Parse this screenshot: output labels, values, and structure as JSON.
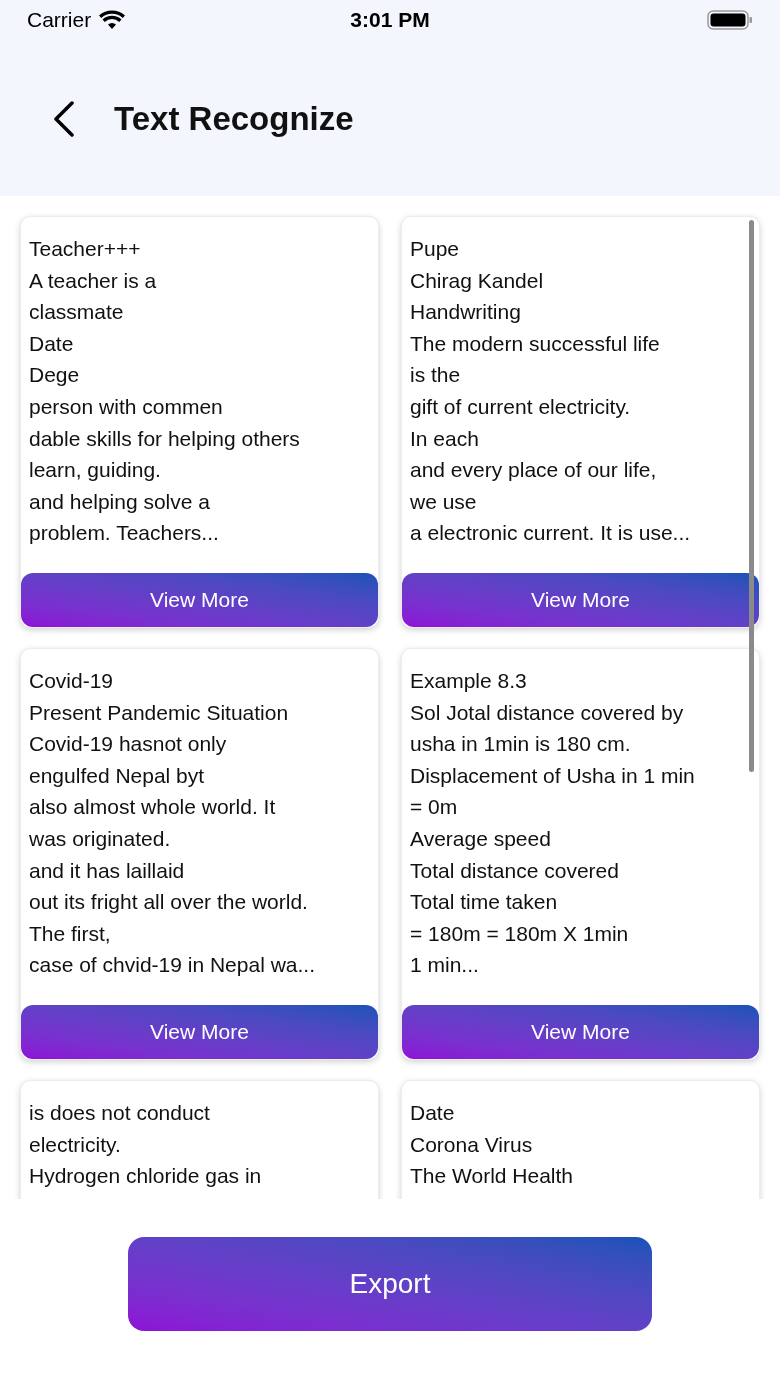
{
  "status_bar": {
    "carrier": "Carrier",
    "time": "3:01 PM"
  },
  "header": {
    "title": "Text Recognize"
  },
  "cards": [
    {
      "lines": [
        "Teacher+++",
        "A teacher is a",
        "classmate",
        "Date",
        "Dege",
        "person with commen",
        "dable skills for helping others",
        "learn, guiding.",
        "and helping solve a",
        "problem. Teachers..."
      ],
      "button": "View More"
    },
    {
      "lines": [
        "Pupe",
        "Chirag Kandel",
        "Handwriting",
        "The modern successful life",
        "is the",
        "gift of current electricity.",
        "In each",
        "and every place of our life,",
        "we use",
        "a electronic current. It is use..."
      ],
      "button": "View More"
    },
    {
      "lines": [
        "Covid-19",
        "Present Pandemic Situation",
        "Covid-19 hasnot only",
        "engulfed Nepal byt",
        "also almost whole world. It",
        "was originated.",
        "and it has laillaid",
        "out its fright all over the world.",
        "The first,",
        "case of chvid-19 in Nepal wa..."
      ],
      "button": "View More"
    },
    {
      "lines": [
        "Example 8.3",
        "Sol Jotal distance covered by",
        "usha in 1min is 180 cm.",
        "Displacement of Usha in 1 min",
        "= 0m",
        "Average speed",
        "Total distance covered",
        "Total time taken",
        "= 180m = 180m X 1min",
        "1 min..."
      ],
      "button": "View More"
    },
    {
      "lines": [
        "is does not conduct",
        "electricity.",
        "Hydrogen chloride gas in"
      ]
    },
    {
      "lines": [
        "Date",
        "Corona Virus",
        "The World Health"
      ]
    }
  ],
  "export_button": "Export"
}
